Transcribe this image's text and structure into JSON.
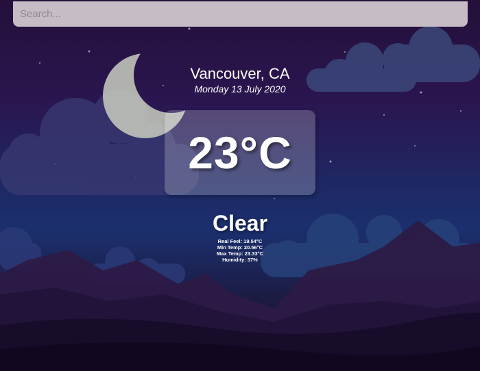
{
  "search": {
    "placeholder": "Search...",
    "value": ""
  },
  "weather": {
    "location": "Vancouver, CA",
    "date": "Monday 13 July 2020",
    "temperature": "23°C",
    "condition": "Clear",
    "details": {
      "real_feel": "Real Feel: 19.54°C",
      "min_temp": "Min Temp: 20.56°C",
      "max_temp": "Max Temp: 23.33°C",
      "humidity": "Humidity: 37%"
    }
  },
  "background": {
    "scene": "night sky with crescent moon, clouds and mountains",
    "icons": [
      "moon-icon",
      "cloud-icon",
      "mountain-silhouette",
      "star-icon"
    ]
  },
  "colors": {
    "sky_top": "#24103a",
    "sky_mid": "#1d2a66",
    "search_bg": "#c5bcc6",
    "text": "#ffffff"
  }
}
